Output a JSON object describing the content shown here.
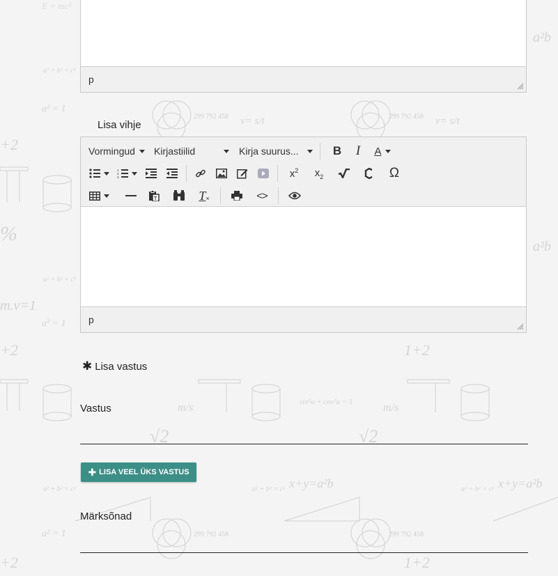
{
  "colors": {
    "accent": "#3c8f87",
    "toolbar_bg": "#f0f0f0",
    "page_bg": "#f4f4f4"
  },
  "top_editor": {
    "status_path": "p"
  },
  "hint_section": {
    "label": "Lisa vihje"
  },
  "hint_editor": {
    "toolbar": {
      "formats_label": "Vormingud",
      "font_family_label": "Kirjastiilid",
      "font_size_label": "Kirja suurus...",
      "icons": [
        "bold-icon",
        "italic-icon",
        "text-color-icon",
        "bullet-list-icon",
        "numbered-list-icon",
        "indent-icon",
        "outdent-icon",
        "link-icon",
        "image-icon",
        "edit-icon",
        "media-icon",
        "superscript-icon",
        "subscript-icon",
        "sqrt-icon",
        "chem-icon",
        "omega-icon",
        "table-icon",
        "horizontal-rule-icon",
        "paste-text-icon",
        "find-replace-icon",
        "clear-format-icon",
        "print-icon",
        "code-icon",
        "preview-icon"
      ]
    },
    "status_path": "p"
  },
  "answer_section": {
    "required_label": "Lisa vastus",
    "answer_field_label": "Vastus",
    "answer_value": "",
    "add_more_button": "LISA VEEL ÜKS VASTUS"
  },
  "keywords_section": {
    "label": "Märksõnad",
    "value": ""
  }
}
